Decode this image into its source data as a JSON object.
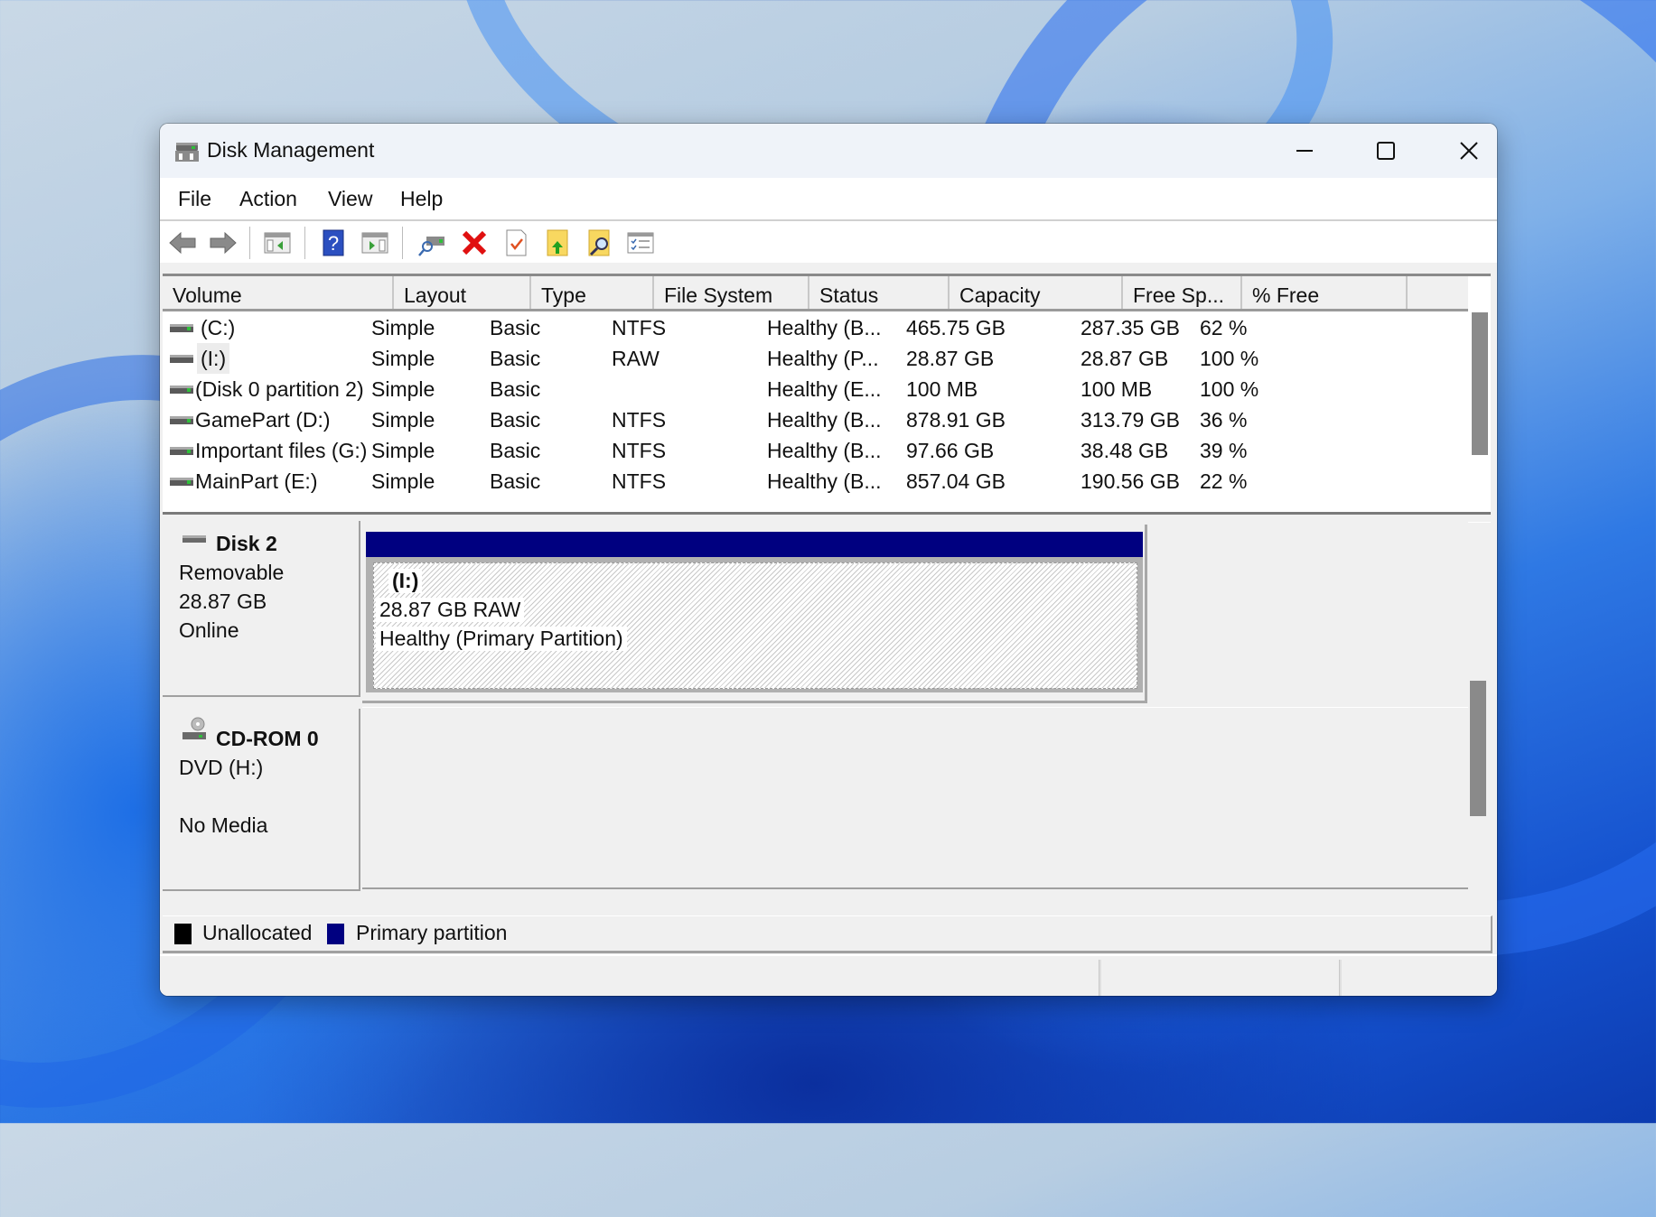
{
  "window": {
    "title": "Disk Management",
    "controls": {
      "minimize": "minimize",
      "maximize": "maximize",
      "close": "close"
    }
  },
  "menu": [
    "File",
    "Action",
    "View",
    "Help"
  ],
  "toolbar": [
    {
      "name": "back-icon"
    },
    {
      "name": "forward-icon"
    },
    {
      "name": "show-hide-console-tree-icon"
    },
    {
      "name": "help-icon"
    },
    {
      "name": "show-hide-action-pane-icon"
    },
    {
      "name": "connect-drive-icon"
    },
    {
      "name": "delete-icon"
    },
    {
      "name": "properties-icon"
    },
    {
      "name": "export-list-icon"
    },
    {
      "name": "search-folder-icon"
    },
    {
      "name": "checklist-icon"
    }
  ],
  "table": {
    "headers": [
      "Volume",
      "Layout",
      "Type",
      "File System",
      "Status",
      "Capacity",
      "Free Sp...",
      "% Free"
    ],
    "rows": [
      {
        "volume": "(C:)",
        "layout": "Simple",
        "type": "Basic",
        "fs": "NTFS",
        "status": "Healthy (B...",
        "capacity": "465.75 GB",
        "free": "287.35 GB",
        "pct": "62 %"
      },
      {
        "volume": "(I:)",
        "layout": "Simple",
        "type": "Basic",
        "fs": "RAW",
        "status": "Healthy (P...",
        "capacity": "28.87 GB",
        "free": "28.87 GB",
        "pct": "100 %"
      },
      {
        "volume": "(Disk 0 partition 2)",
        "layout": "Simple",
        "type": "Basic",
        "fs": "",
        "status": "Healthy (E...",
        "capacity": "100 MB",
        "free": "100 MB",
        "pct": "100 %"
      },
      {
        "volume": "GamePart (D:)",
        "layout": "Simple",
        "type": "Basic",
        "fs": "NTFS",
        "status": "Healthy (B...",
        "capacity": "878.91 GB",
        "free": "313.79 GB",
        "pct": "36 %"
      },
      {
        "volume": "Important files (G:)",
        "layout": "Simple",
        "type": "Basic",
        "fs": "NTFS",
        "status": "Healthy (B...",
        "capacity": "97.66 GB",
        "free": "38.48 GB",
        "pct": "39 %"
      },
      {
        "volume": "MainPart (E:)",
        "layout": "Simple",
        "type": "Basic",
        "fs": "NTFS",
        "status": "Healthy (B...",
        "capacity": "857.04 GB",
        "free": "190.56 GB",
        "pct": "22 %"
      }
    ]
  },
  "disks": [
    {
      "title": "Disk 2",
      "kind": "Removable",
      "size": "28.87 GB",
      "state": "Online",
      "partition": {
        "label": "(I:)",
        "size_fs": "28.87 GB RAW",
        "status": "Healthy (Primary Partition)"
      }
    },
    {
      "title": "CD-ROM 0",
      "kind": "DVD (H:)",
      "size": "",
      "state": "No Media"
    }
  ],
  "legend": [
    {
      "label": "Unallocated",
      "color": "#000000"
    },
    {
      "label": "Primary partition",
      "color": "#000080"
    }
  ],
  "colors": {
    "primary_partition": "#000080",
    "unallocated": "#000000"
  }
}
